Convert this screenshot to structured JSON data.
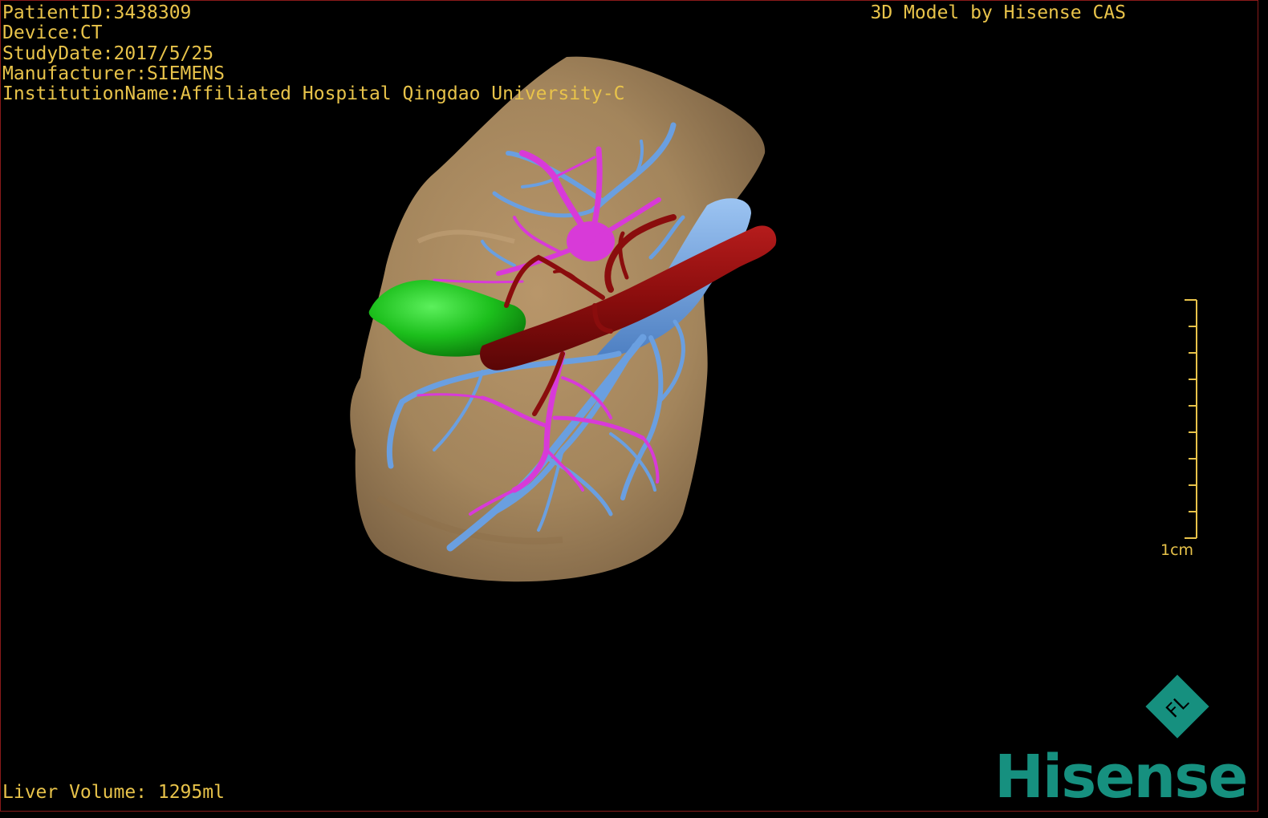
{
  "patient_info": {
    "patient_id": "PatientID:3438309",
    "device": "Device:CT",
    "study_date": "StudyDate:2017/5/25",
    "manufacturer": "Manufacturer:SIEMENS",
    "institution": "InstitutionName:Affiliated Hospital Qingdao University-C"
  },
  "header": {
    "model_credit": "3D Model by Hisense CAS"
  },
  "footer": {
    "liver_volume": "Liver Volume: 1295ml"
  },
  "scale_bar": {
    "label": "1cm"
  },
  "logo": {
    "text": "Hisense",
    "mark_text": "FL"
  },
  "colors": {
    "overlay_text": "#e8c34a",
    "liver": "#a88a62",
    "gallbladder": "#1ec81e",
    "portal_vein": "#6a9fe0",
    "hepatic_vein": "#d83ad8",
    "artery": "#8a0d0d",
    "brand": "#16907f"
  }
}
